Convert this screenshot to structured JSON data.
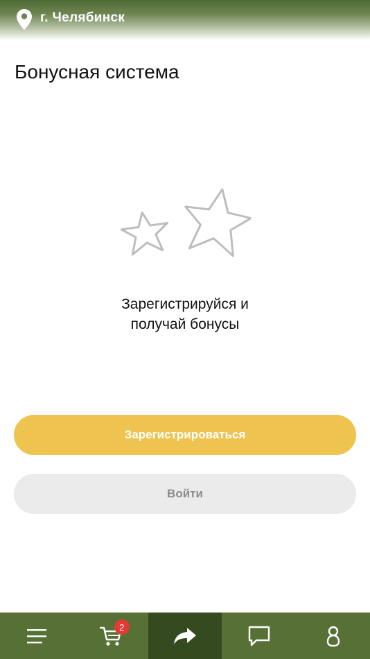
{
  "header": {
    "location_icon": "location-pin-icon",
    "city": "г. Челябинск"
  },
  "page": {
    "title": "Бонусная система"
  },
  "empty_state": {
    "icon": "stars-icon",
    "line1": "Зарегистрируйся и",
    "line2": "получай бонусы"
  },
  "buttons": {
    "register_label": "Зарегистрироваться",
    "login_label": "Войти"
  },
  "bottom_nav": {
    "items": [
      {
        "icon": "menu-icon",
        "active": false
      },
      {
        "icon": "cart-icon",
        "active": false,
        "badge": "2"
      },
      {
        "icon": "share-icon",
        "active": true
      },
      {
        "icon": "chat-icon",
        "active": false
      },
      {
        "icon": "profile-icon",
        "active": false
      }
    ]
  },
  "colors": {
    "brand_green": "#567035",
    "active_green": "#364a20",
    "accent_yellow": "#eec34f",
    "badge_red": "#e53935",
    "secondary_button": "#ecebeb"
  }
}
